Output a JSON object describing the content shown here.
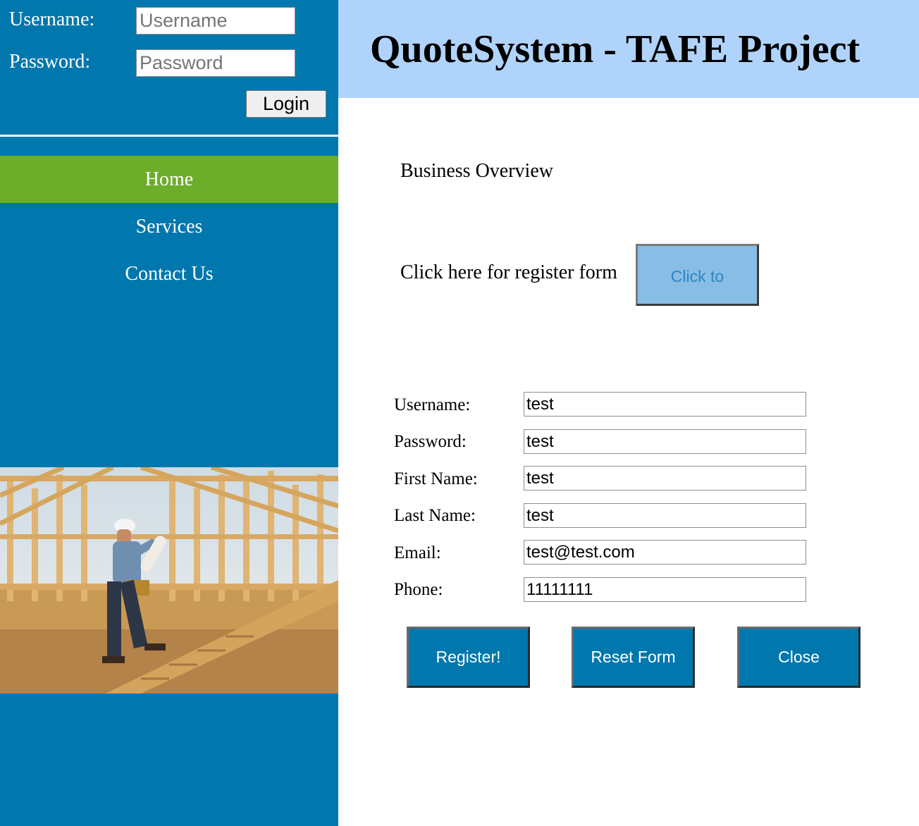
{
  "login": {
    "username_label": "Username:",
    "username_placeholder": "Username",
    "password_label": "Password:",
    "password_placeholder": "Password",
    "login_button": "Login"
  },
  "nav": {
    "items": [
      {
        "label": "Home",
        "active": true
      },
      {
        "label": "Services",
        "active": false
      },
      {
        "label": "Contact Us",
        "active": false
      }
    ]
  },
  "header": {
    "title": "QuoteSystem - TAFE Project"
  },
  "main": {
    "overview": "Business Overview",
    "register_prompt": "Click here for register form",
    "click_button": "Click to"
  },
  "form": {
    "fields": [
      {
        "label": "Username:",
        "value": "test"
      },
      {
        "label": "Password:",
        "value": "test"
      },
      {
        "label": "First Name:",
        "value": "test"
      },
      {
        "label": "Last Name:",
        "value": "test"
      },
      {
        "label": "Email:",
        "value": "test@test.com"
      },
      {
        "label": "Phone:",
        "value": "11111111"
      }
    ],
    "register_button": "Register!",
    "reset_button": "Reset Form",
    "close_button": "Close"
  },
  "colors": {
    "sidebar": "#0077ad",
    "nav_active": "#6cad2a",
    "header": "#b0d3fb",
    "click_button": "#88bde6"
  }
}
